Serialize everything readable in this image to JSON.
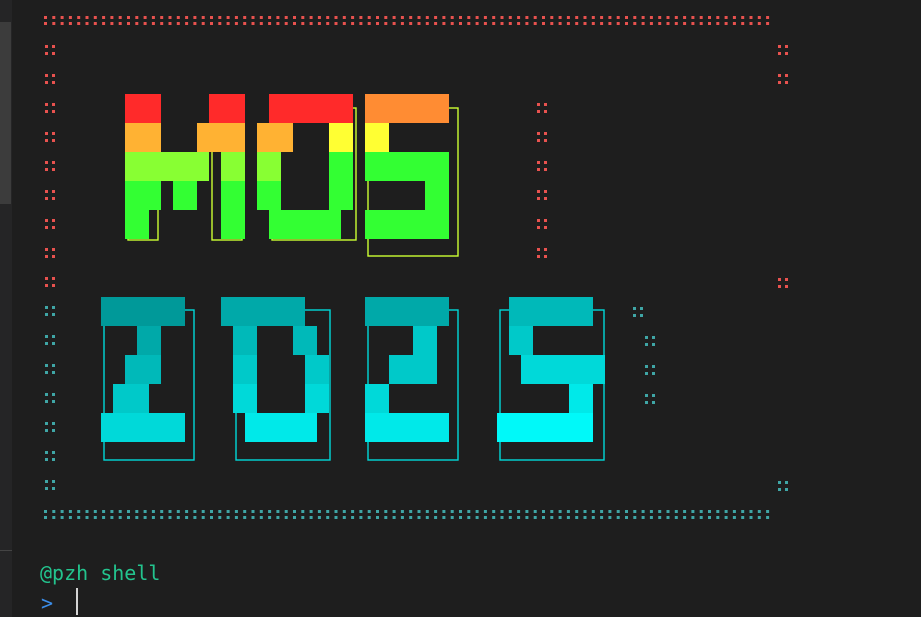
{
  "terminal": {
    "prompt_user": "@pzh shell",
    "prompt_symbol": ">",
    "input_value": ""
  },
  "banner": {
    "line1": "MOS",
    "line2": "2025",
    "frame_glyph": "::"
  },
  "colors": {
    "background": "#1e1e1e",
    "frame_top": "#e8524f",
    "frame_bottom": "#3fa6a6",
    "gradient_top": [
      "#ff2a2a",
      "#ff5a33",
      "#ff8c33",
      "#ffb233",
      "#ffd633",
      "#ffff33",
      "#ccff33",
      "#88ff33",
      "#33ff33"
    ],
    "gradient_bottom": [
      "#009999",
      "#00a9a9",
      "#00b9b9",
      "#00c9c9",
      "#00d9d9",
      "#00e9e9",
      "#00f9f9",
      "#00ffff"
    ],
    "prompt_user": "#23c48e",
    "prompt_symbol": "#3b8eea"
  }
}
